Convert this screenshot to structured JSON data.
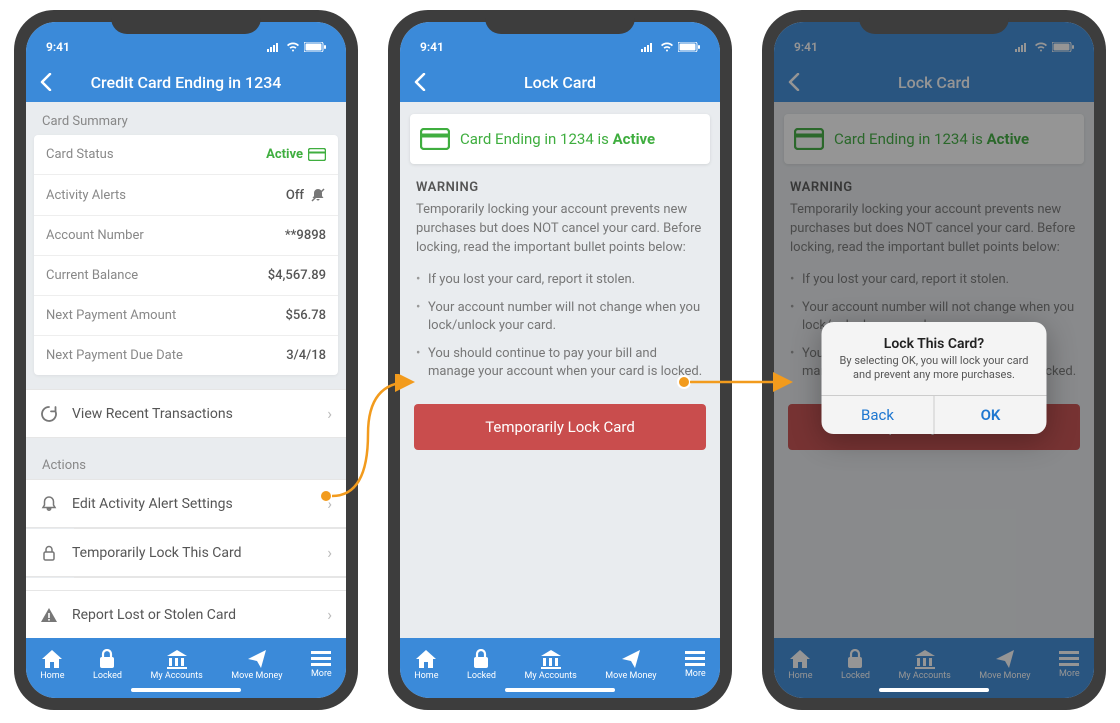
{
  "status_bar": {
    "time": "9:41"
  },
  "tabs": [
    {
      "label": "Home"
    },
    {
      "label": "Locked"
    },
    {
      "label": "My Accounts"
    },
    {
      "label": "Move Money"
    },
    {
      "label": "More"
    }
  ],
  "screen1": {
    "title": "Credit Card Ending in 1234",
    "summary_label": "Card Summary",
    "rows": {
      "status_label": "Card Status",
      "status_value": "Active",
      "alerts_label": "Activity Alerts",
      "alerts_value": "Off",
      "acct_label": "Account Number",
      "acct_value": "**9898",
      "balance_label": "Current Balance",
      "balance_value": "$4,567.89",
      "nextpay_label": "Next Payment Amount",
      "nextpay_value": "$56.78",
      "duedate_label": "Next Payment Due Date",
      "duedate_value": "3/4/18"
    },
    "recent": "View Recent Transactions",
    "actions_label": "Actions",
    "action1": "Edit Activity Alert Settings",
    "action2": "Temporarily Lock This Card",
    "action3": "Report Lost or Stolen Card"
  },
  "screen2": {
    "title": "Lock Card",
    "banner_prefix": "Card Ending in 1234 is ",
    "banner_status": "Active",
    "warn_title": "WARNING",
    "warn_body": "Temporarily locking your account prevents new purchases but does NOT cancel your card. Before locking, read the important bullet points below:",
    "bullets": [
      "If you lost your card, report it stolen.",
      "Your account number will not change when you lock/unlock your card.",
      "You should continue to pay your bill and manage your account when your card is locked."
    ],
    "button": "Temporarily Lock Card"
  },
  "screen3": {
    "alert_title": "Lock This Card?",
    "alert_msg": "By selecting OK, you will lock your card and prevent any more purchases.",
    "alert_back": "Back",
    "alert_ok": "OK"
  }
}
